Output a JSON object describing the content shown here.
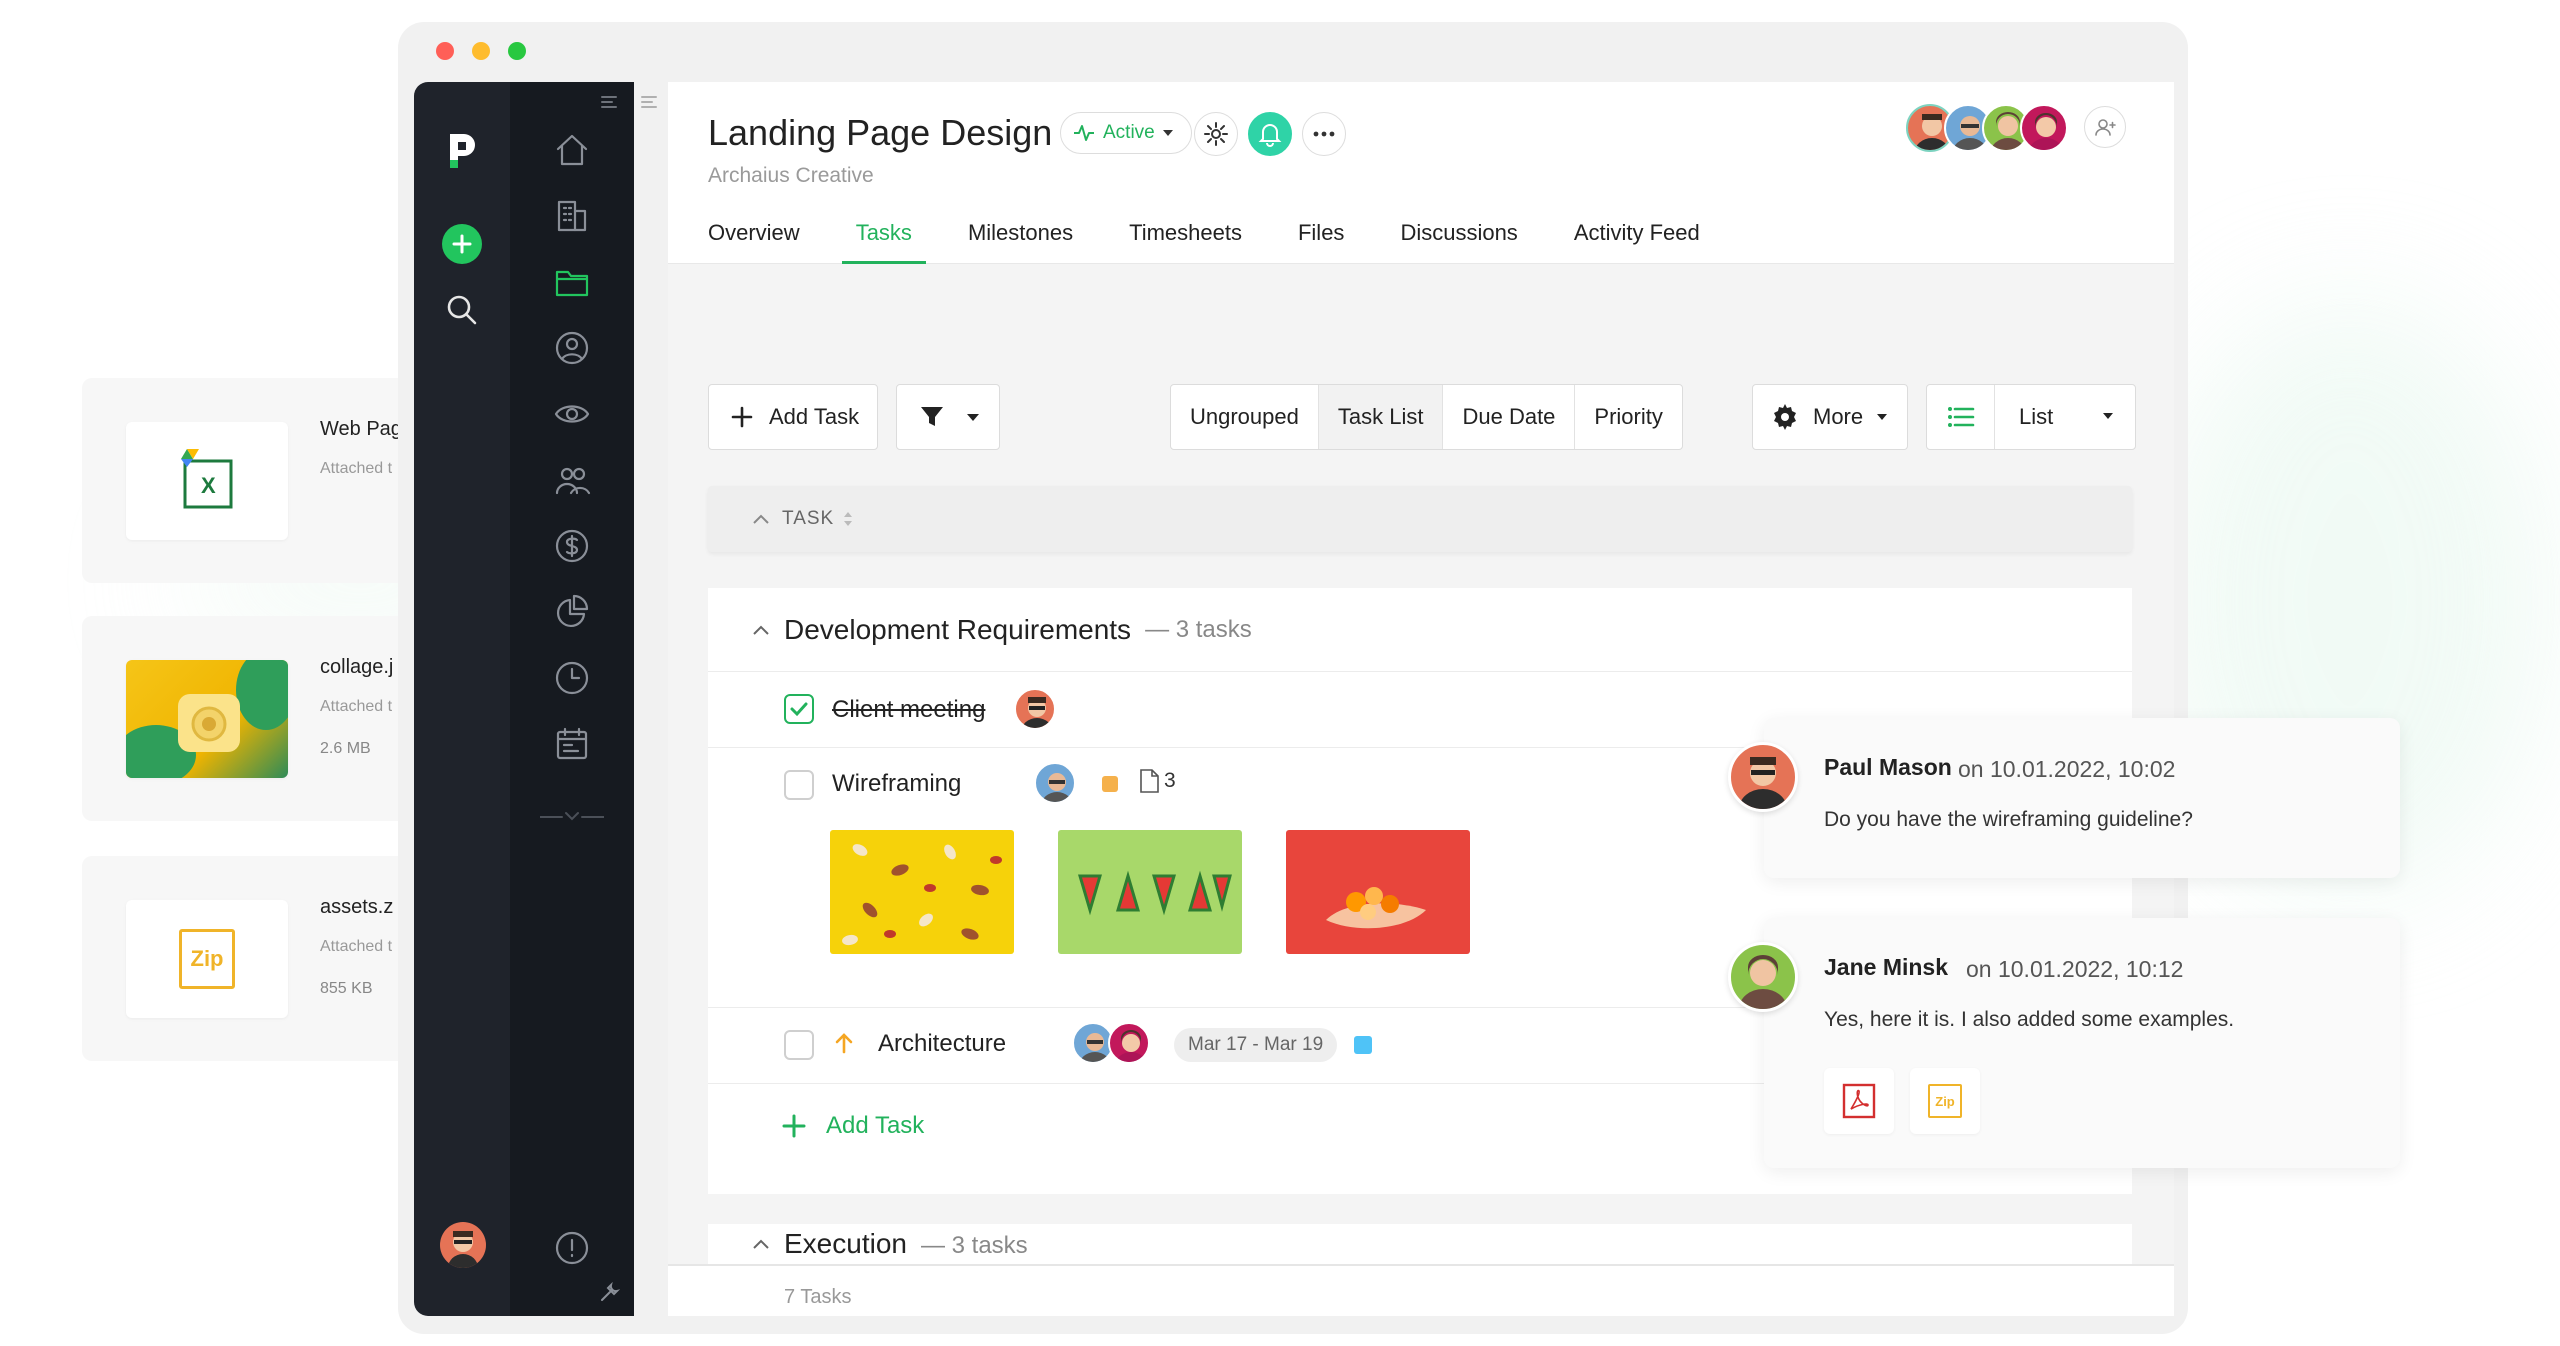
{
  "app": {
    "project_title": "Landing Page Design",
    "project_client": "Archaius Creative",
    "status_label": "Active"
  },
  "tabs": [
    {
      "label": "Overview"
    },
    {
      "label": "Tasks"
    },
    {
      "label": "Milestones"
    },
    {
      "label": "Timesheets"
    },
    {
      "label": "Files"
    },
    {
      "label": "Discussions"
    },
    {
      "label": "Activity Feed"
    }
  ],
  "toolbar": {
    "add_task": "Add Task",
    "grouping": [
      {
        "label": "Ungrouped"
      },
      {
        "label": "Task List"
      },
      {
        "label": "Due Date"
      },
      {
        "label": "Priority"
      }
    ],
    "more": "More",
    "view": "List"
  },
  "table": {
    "column_task": "TASK"
  },
  "groups": [
    {
      "title": "Development Requirements",
      "count": "— 3 tasks",
      "tasks": [
        {
          "name": "Client meeting",
          "done": true
        },
        {
          "name": "Wireframing",
          "attachments_count": "3"
        },
        {
          "name": "Architecture",
          "dates": "Mar 17 - Mar 19"
        }
      ],
      "add_task": "Add Task"
    },
    {
      "title": "Execution",
      "count": "— 3 tasks"
    }
  ],
  "footer": {
    "count": "7 Tasks"
  },
  "attachments": [
    {
      "name": "Web Pag",
      "sub": "Attached t"
    },
    {
      "name": "collage.j",
      "sub": "Attached t",
      "size": "2.6 MB"
    },
    {
      "name": "assets.z",
      "sub": "Attached t",
      "size": "855 KB"
    }
  ],
  "comments": [
    {
      "author": "Paul Mason",
      "time": "on 10.01.2022, 10:02",
      "text": "Do you have the wireframing guideline?"
    },
    {
      "author": "Jane Minsk",
      "time": "on 10.01.2022, 10:12",
      "text": "Yes, here it is. I also added some examples.",
      "files": [
        "PDF",
        "Zip"
      ]
    }
  ],
  "icons": {
    "rail": [
      "logo-icon",
      "add-icon",
      "search-icon",
      "user-avatar"
    ],
    "nav": [
      "home-icon",
      "building-icon",
      "folder-icon",
      "user-circle-icon",
      "eye-icon",
      "team-icon",
      "dollar-icon",
      "chart-pie-icon",
      "clock-icon",
      "calendar-icon",
      "collapse-icon",
      "info-icon",
      "wrench-icon"
    ]
  },
  "colors": {
    "accent": "#22b25c",
    "sidebar_dark": "#161a20",
    "rail_dark": "#1f232b",
    "priority_orange": "#f5b14c",
    "tag_blue": "#4fc3f7"
  }
}
